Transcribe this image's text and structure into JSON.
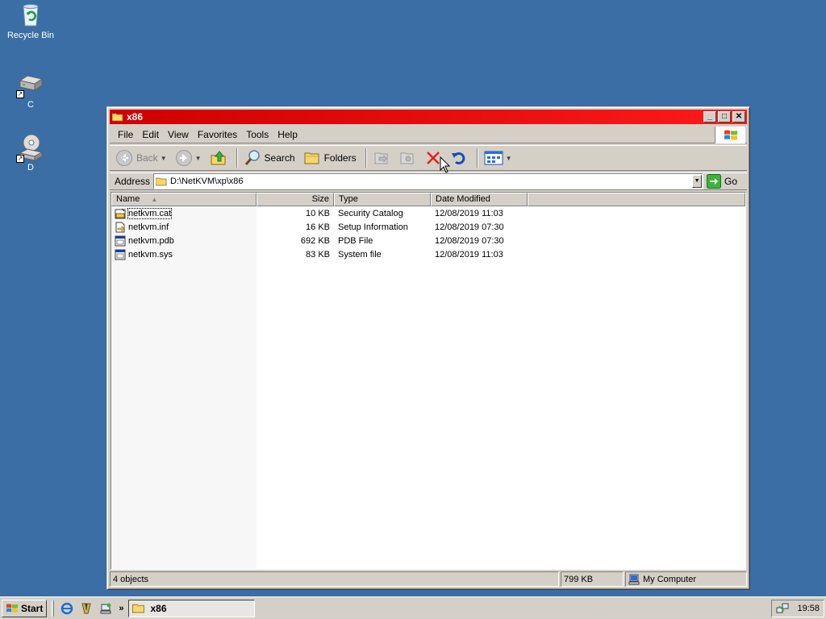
{
  "desktop": {
    "icons": [
      {
        "label": "Recycle Bin",
        "icon": "recycle-bin-icon"
      },
      {
        "label": "C",
        "icon": "hard-drive-icon"
      },
      {
        "label": "D",
        "icon": "cd-drive-icon"
      }
    ]
  },
  "window": {
    "title": "x86",
    "menu": [
      {
        "label": "File",
        "accel": "F"
      },
      {
        "label": "Edit",
        "accel": "E"
      },
      {
        "label": "View",
        "accel": "V"
      },
      {
        "label": "Favorites",
        "accel": "a"
      },
      {
        "label": "Tools",
        "accel": "T"
      },
      {
        "label": "Help",
        "accel": "H"
      }
    ],
    "toolbar": {
      "back_label": "Back",
      "search_label": "Search",
      "folders_label": "Folders"
    },
    "address": {
      "label": "Address",
      "value": "D:\\NetKVM\\xp\\x86",
      "go_label": "Go"
    },
    "columns": {
      "name": "Name",
      "size": "Size",
      "type": "Type",
      "date": "Date Modified"
    },
    "files": [
      {
        "name": "netkvm.cat",
        "size": "10 KB",
        "type": "Security Catalog",
        "date": "12/08/2019 11:03",
        "icon": "catalog-file-icon"
      },
      {
        "name": "netkvm.inf",
        "size": "16 KB",
        "type": "Setup Information",
        "date": "12/08/2019 07:30",
        "icon": "setup-info-file-icon"
      },
      {
        "name": "netkvm.pdb",
        "size": "692 KB",
        "type": "PDB File",
        "date": "12/08/2019 07:30",
        "icon": "pdb-file-icon"
      },
      {
        "name": "netkvm.sys",
        "size": "83 KB",
        "type": "System file",
        "date": "12/08/2019 11:03",
        "icon": "system-file-icon"
      }
    ],
    "status": {
      "objects": "4 objects",
      "size": "799 KB",
      "zone": "My Computer"
    }
  },
  "taskbar": {
    "start_label": "Start",
    "quick_launch_more": "»",
    "task_label": "x86",
    "clock": "19:58"
  }
}
